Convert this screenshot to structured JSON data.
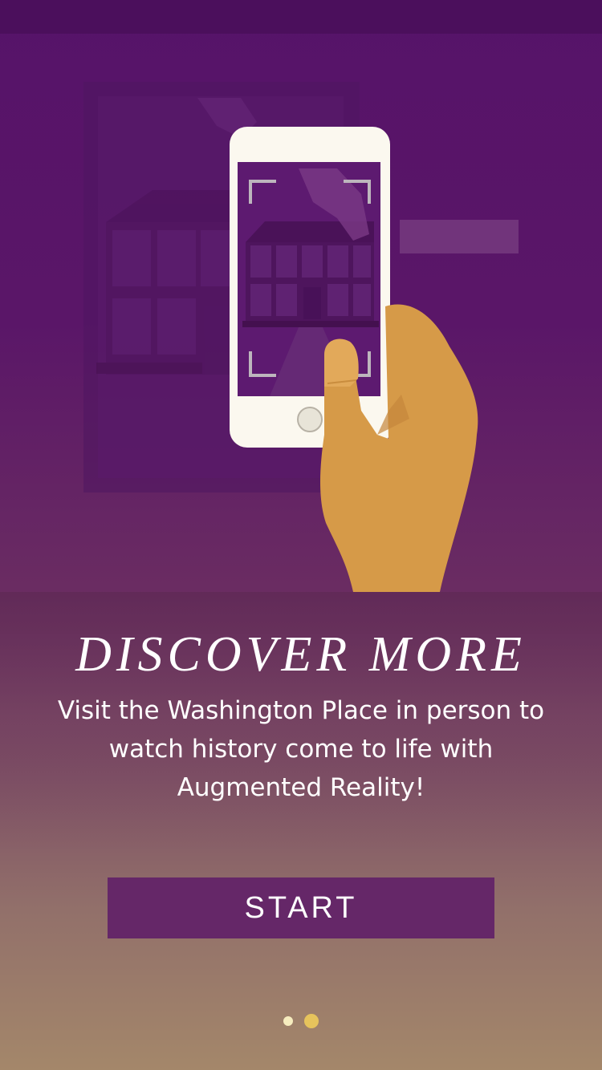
{
  "onboarding": {
    "title": "DISCOVER MORE",
    "description": "Visit the Washington Place in person to watch history come to life with Augmented Reality!",
    "start_label": "START",
    "pagination": {
      "total_pages": 2,
      "current_page": 2
    }
  },
  "colors": {
    "status_bar": "#4b0f5c",
    "background_top": "#561369",
    "background_bottom": "#a4876a",
    "button": "#652768",
    "dot_active": "#e6c35c",
    "dot_inactive": "#f6ecbe"
  },
  "illustration": {
    "subject": "hand holding phone scanning a historic building with augmented reality"
  }
}
